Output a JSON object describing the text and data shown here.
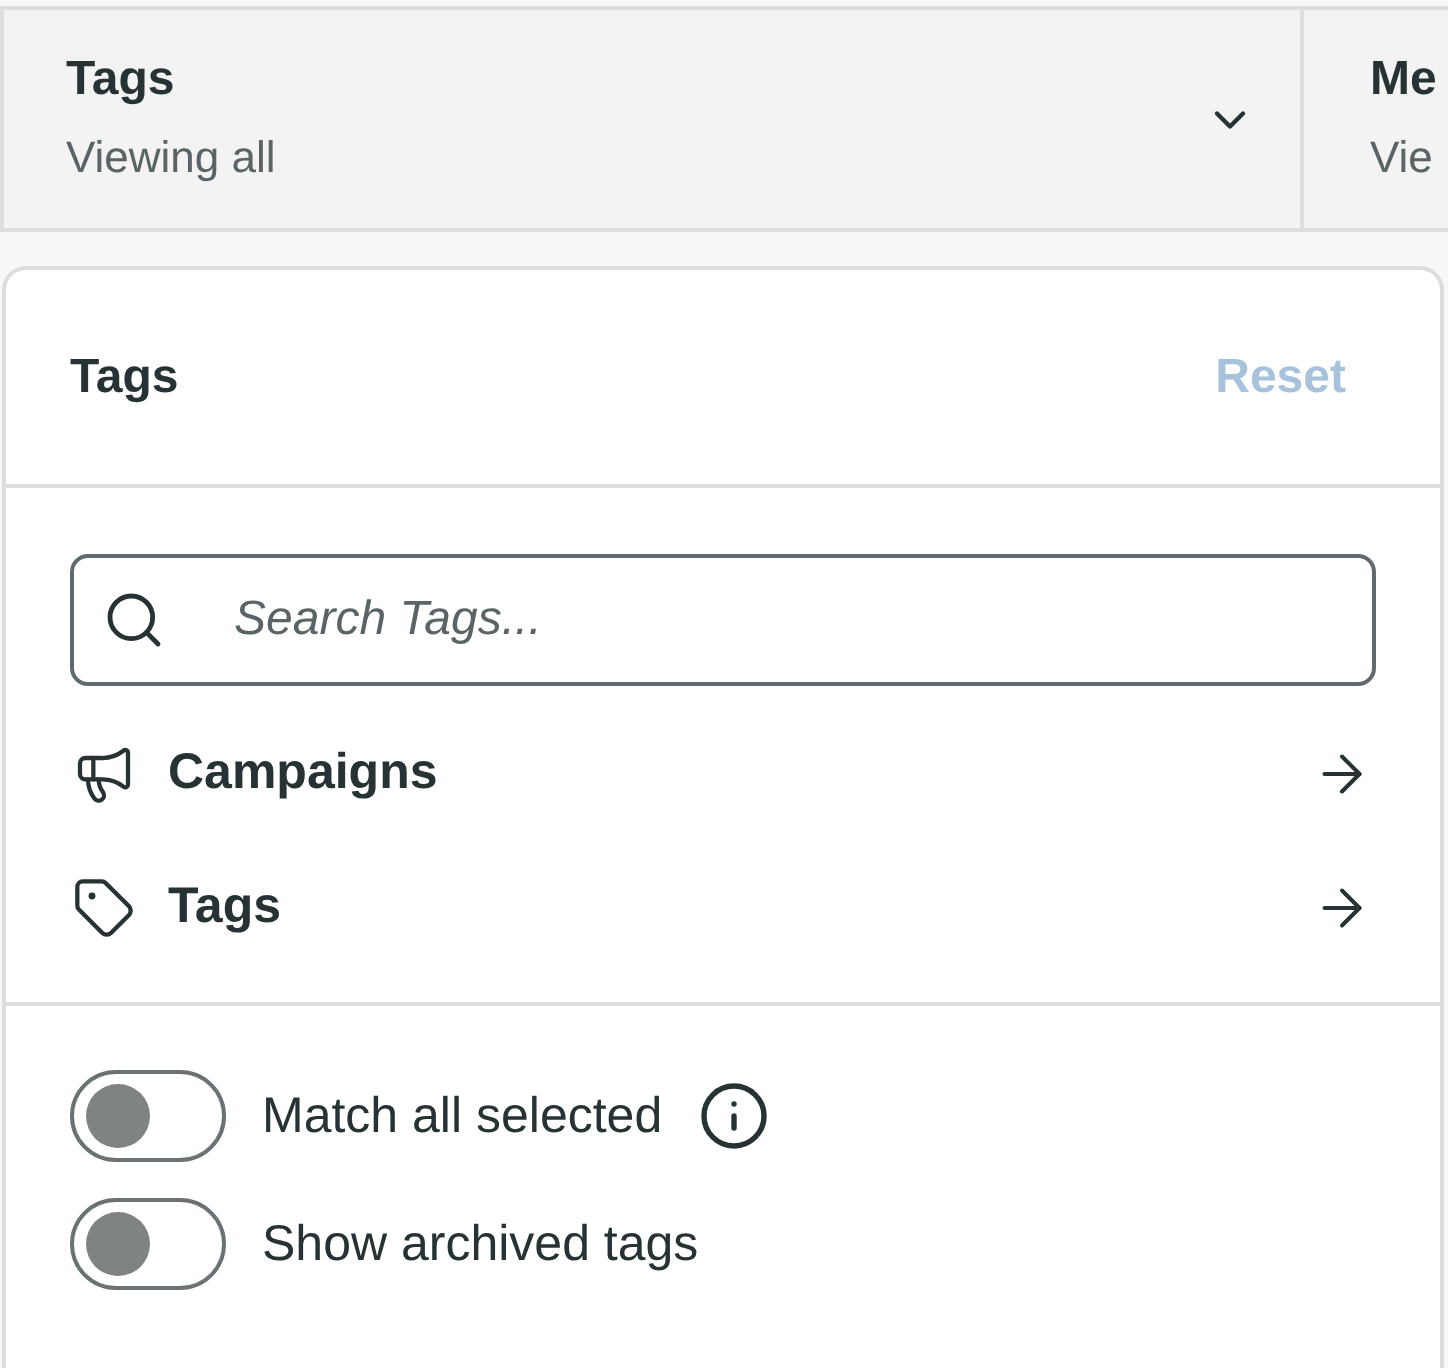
{
  "filter_bar": {
    "filters": [
      {
        "title": "Tags",
        "subtitle": "Viewing all",
        "chevron": true
      },
      {
        "title": "Me",
        "subtitle": "Vie"
      }
    ]
  },
  "panel": {
    "title": "Tags",
    "reset": {
      "label": "Reset",
      "disabled": true
    },
    "search": {
      "placeholder": "Search Tags..."
    },
    "menu_items": [
      {
        "label": "Campaigns"
      },
      {
        "label": "Tags"
      }
    ],
    "toggles": [
      {
        "label": "Match all selected",
        "on": false,
        "info": true
      },
      {
        "label": "Show archived tags",
        "on": false
      }
    ]
  }
}
